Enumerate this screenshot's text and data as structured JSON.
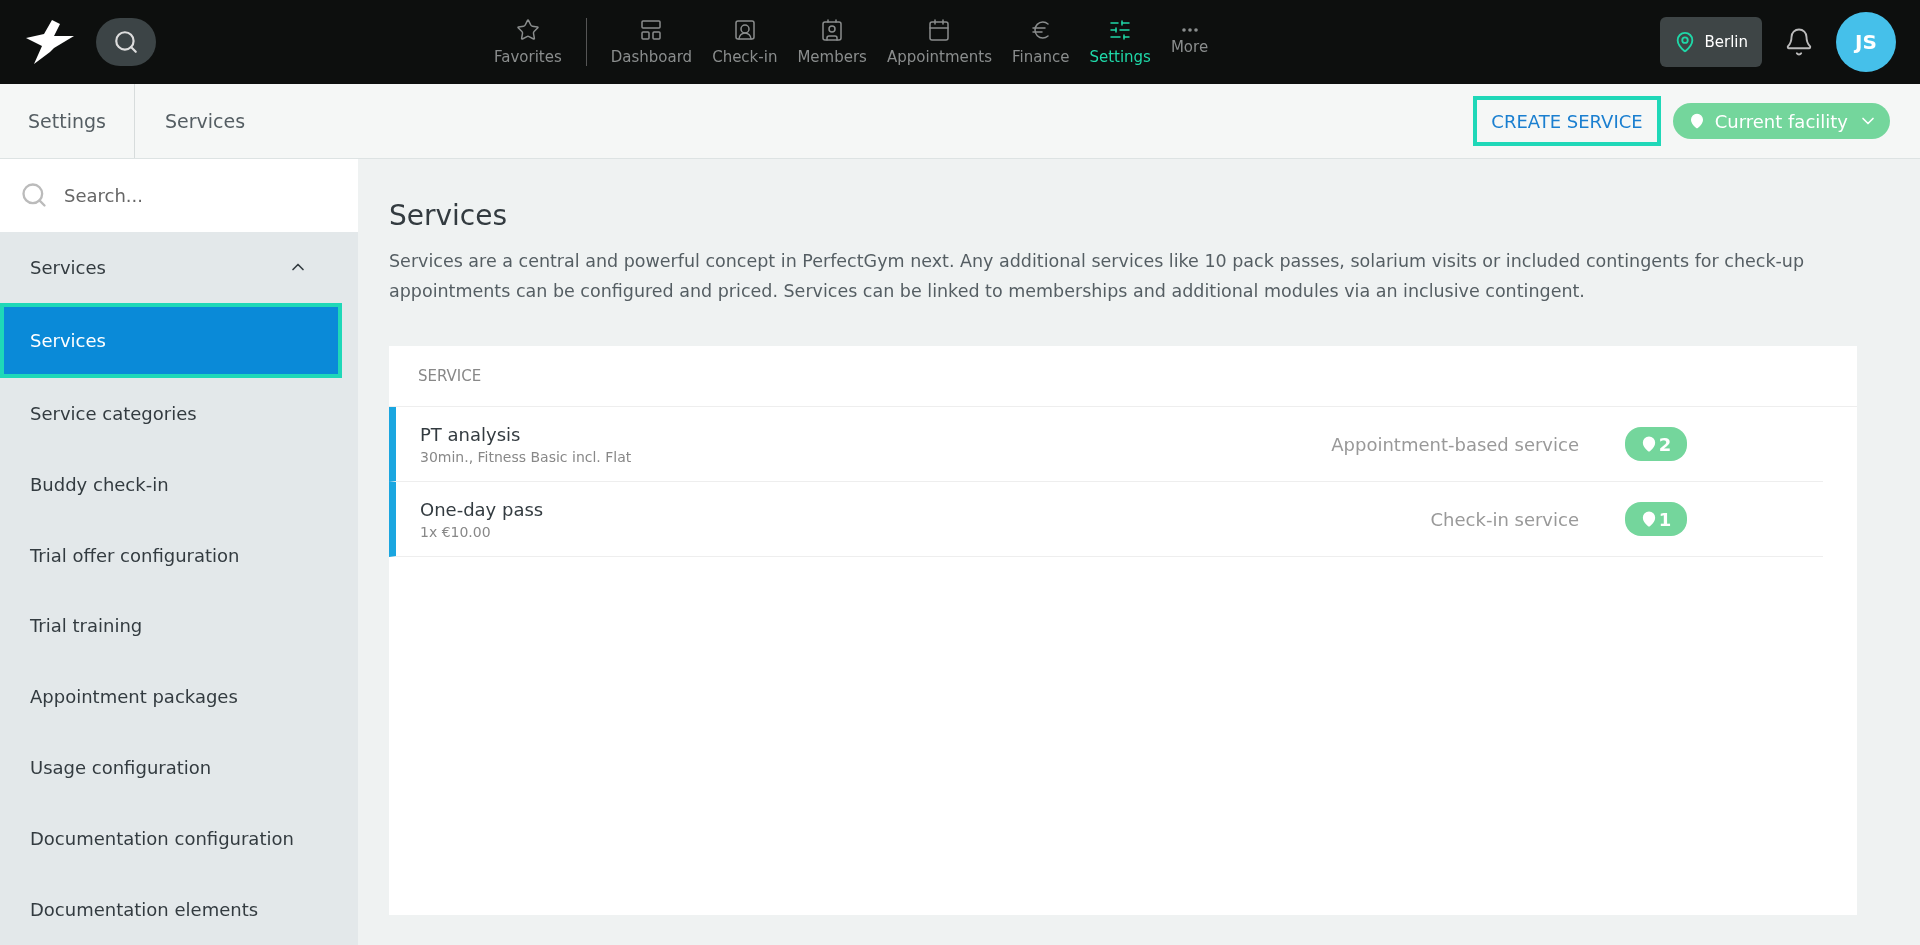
{
  "top_nav": {
    "items": [
      {
        "label": "Favorites",
        "selected": false
      },
      {
        "label": "Dashboard",
        "selected": false
      },
      {
        "label": "Check-in",
        "selected": false
      },
      {
        "label": "Members",
        "selected": false
      },
      {
        "label": "Appointments",
        "selected": false
      },
      {
        "label": "Finance",
        "selected": false
      },
      {
        "label": "Settings",
        "selected": true
      },
      {
        "label": "More",
        "selected": false
      }
    ],
    "location": "Berlin",
    "avatar": "JS"
  },
  "breadcrumb": [
    "Settings",
    "Services"
  ],
  "create_button": "CREATE SERVICE",
  "facility_dropdown": "Current facility",
  "sidebar": {
    "search_placeholder": "Search...",
    "group": {
      "label": "Services",
      "expanded": true
    },
    "items": [
      {
        "label": "Services",
        "selected": true
      },
      {
        "label": "Service categories",
        "selected": false
      },
      {
        "label": "Buddy check-in",
        "selected": false
      },
      {
        "label": "Trial offer configuration",
        "selected": false
      },
      {
        "label": "Trial training",
        "selected": false
      },
      {
        "label": "Appointment packages",
        "selected": false
      },
      {
        "label": "Usage configuration",
        "selected": false
      },
      {
        "label": "Documentation configuration",
        "selected": false
      },
      {
        "label": "Documentation elements",
        "selected": false
      }
    ]
  },
  "page": {
    "title": "Services",
    "description": "Services are a central and powerful concept in PerfectGym next. Any additional services like 10 pack passes, solarium visits or included contingents for check-up appointments can be configured and priced. Services can be linked to memberships and additional modules via an inclusive contingent."
  },
  "table": {
    "columns": [
      "SERVICE"
    ],
    "rows": [
      {
        "name": "PT analysis",
        "details": "30min., Fitness Basic incl. Flat",
        "type": "Appointment-based service",
        "facilities": "2"
      },
      {
        "name": "One-day pass",
        "details": "1x €10.00",
        "type": "Check-in service",
        "facilities": "1"
      }
    ]
  }
}
